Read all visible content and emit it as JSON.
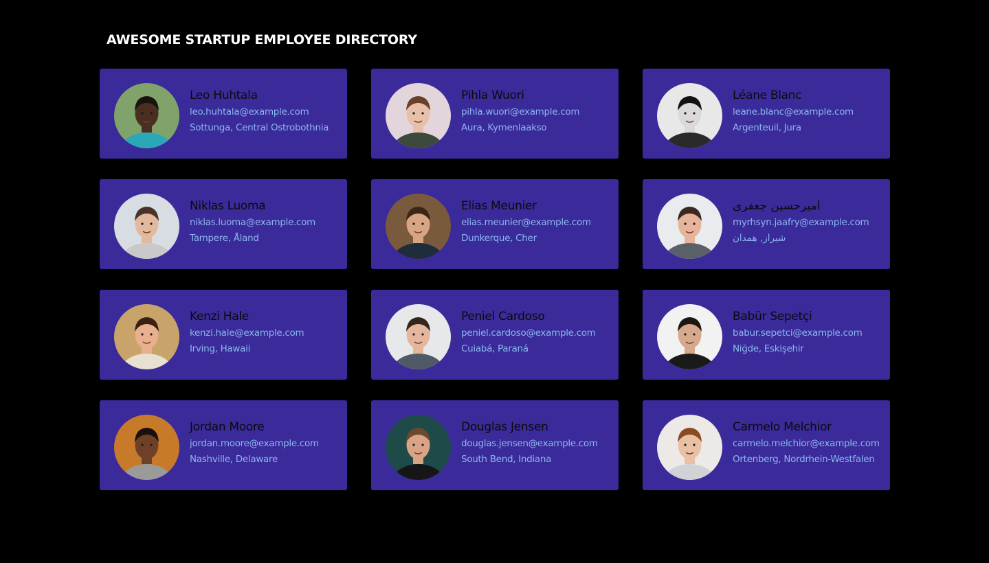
{
  "page": {
    "title": "AWESOME STARTUP EMPLOYEE DIRECTORY"
  },
  "colors": {
    "background": "#000000",
    "card": "#3b2a9a",
    "name_text": "#0a0a0a",
    "detail_text": "#8ab8ee",
    "title_text": "#ffffff"
  },
  "employees": [
    {
      "name": "Leo Huhtala",
      "email": "leo.huhtala@example.com",
      "location": "Sottunga, Central Ostrobothnia",
      "avatar": {
        "bg": "#7fa36a",
        "skin": "#4a2e1f",
        "hair": "#1a120c",
        "shirt": "#2aa8b8"
      }
    },
    {
      "name": "Pihla Wuori",
      "email": "pihla.wuori@example.com",
      "location": "Aura, Kymenlaakso",
      "avatar": {
        "bg": "#e3d5dc",
        "skin": "#e8bfa8",
        "hair": "#6b4028",
        "shirt": "#3b4a3a"
      }
    },
    {
      "name": "Léane Blanc",
      "email": "leane.blanc@example.com",
      "location": "Argenteuil, Jura",
      "avatar": {
        "bg": "#e8e8e8",
        "skin": "#d9d9d9",
        "hair": "#111111",
        "shirt": "#2a2a2a"
      }
    },
    {
      "name": "Niklas Luoma",
      "email": "niklas.luoma@example.com",
      "location": "Tampere, Åland",
      "avatar": {
        "bg": "#d8dde3",
        "skin": "#e2b99d",
        "hair": "#4a3226",
        "shirt": "#c9c9c9"
      }
    },
    {
      "name": "Elias Meunier",
      "email": "elias.meunier@example.com",
      "location": "Dunkerque, Cher",
      "avatar": {
        "bg": "#7a5a3c",
        "skin": "#d8a584",
        "hair": "#3b2618",
        "shirt": "#1f2c3c"
      }
    },
    {
      "name": "اميرحسين جعفری",
      "email": "myrhsyn.jaafry@example.com",
      "location": "شیراز, همدان",
      "avatar": {
        "bg": "#e9ecef",
        "skin": "#e5b49a",
        "hair": "#3a2a20",
        "shirt": "#5a6068"
      }
    },
    {
      "name": "Kenzi Hale",
      "email": "kenzi.hale@example.com",
      "location": "Irving, Hawaii",
      "avatar": {
        "bg": "#c9a46a",
        "skin": "#e8b08e",
        "hair": "#3a1f14",
        "shirt": "#e8e0d0"
      }
    },
    {
      "name": "Peniel Cardoso",
      "email": "peniel.cardoso@example.com",
      "location": "Cuiabá, Paraná",
      "avatar": {
        "bg": "#e6e8ea",
        "skin": "#e4b69c",
        "hair": "#33261d",
        "shirt": "#4f5a66"
      }
    },
    {
      "name": "Babür Sepetçi",
      "email": "babur.sepetci@example.com",
      "location": "Niğde, Eskişehir",
      "avatar": {
        "bg": "#f2f2f2",
        "skin": "#d7a98c",
        "hair": "#1c1712",
        "shirt": "#1a1a1a"
      }
    },
    {
      "name": "Jordan Moore",
      "email": "jordan.moore@example.com",
      "location": "Nashville, Delaware",
      "avatar": {
        "bg": "#c77a2a",
        "skin": "#6e4028",
        "hair": "#1a100a",
        "shirt": "#9a9a9a"
      }
    },
    {
      "name": "Douglas Jensen",
      "email": "douglas.jensen@example.com",
      "location": "South Bend, Indiana",
      "avatar": {
        "bg": "#1f4a4a",
        "skin": "#d9a486",
        "hair": "#6a4a2a",
        "shirt": "#161616"
      }
    },
    {
      "name": "Carmelo Melchior",
      "email": "carmelo.melchior@example.com",
      "location": "Ortenberg, Nordrhein-Westfalen",
      "avatar": {
        "bg": "#ece9e6",
        "skin": "#eac0a4",
        "hair": "#8a4a22",
        "shirt": "#cfd3d6"
      }
    }
  ]
}
